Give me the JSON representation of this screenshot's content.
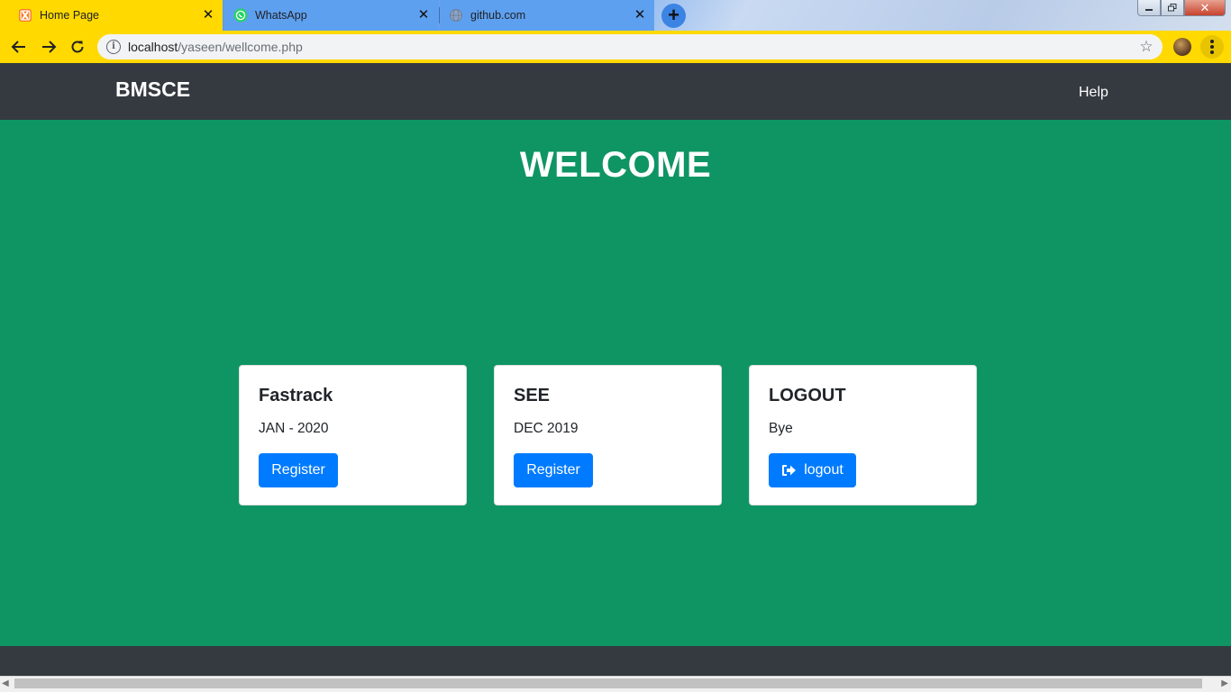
{
  "browser": {
    "tabs": [
      {
        "title": "Home Page",
        "icon": "xampp-icon",
        "active": true
      },
      {
        "title": "WhatsApp",
        "icon": "whatsapp-icon",
        "active": false
      },
      {
        "title": "github.com",
        "icon": "globe-icon",
        "active": false
      }
    ],
    "url_host": "localhost",
    "url_path": "/yaseen/wellcome.php",
    "theme_color": "#ffd900"
  },
  "navbar": {
    "brand": "BMSCE",
    "help": "Help"
  },
  "hero": {
    "heading": "WELCOME"
  },
  "cards": [
    {
      "title": "Fastrack",
      "text": "JAN - 2020",
      "button": "Register"
    },
    {
      "title": "SEE",
      "text": "DEC 2019",
      "button": "Register"
    },
    {
      "title": "LOGOUT",
      "text": "Bye",
      "button": "logout",
      "button_icon": "sign-out-icon"
    }
  ],
  "colors": {
    "navbar": "#343a40",
    "main_bg": "#0e9563",
    "button": "#007bff"
  }
}
